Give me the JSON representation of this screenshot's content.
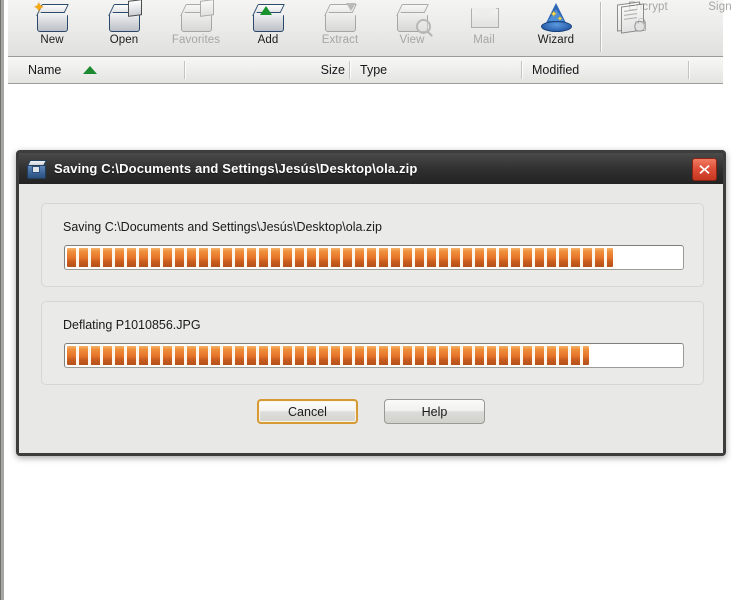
{
  "window": {
    "toolbar": {
      "buttons": [
        {
          "label": "New",
          "icon": "new-archive-icon",
          "enabled": true
        },
        {
          "label": "Open",
          "icon": "open-archive-icon",
          "enabled": true
        },
        {
          "label": "Favorites",
          "icon": "favorites-icon",
          "enabled": false
        },
        {
          "label": "Add",
          "icon": "add-to-archive-icon",
          "enabled": true
        },
        {
          "label": "Extract",
          "icon": "extract-icon",
          "enabled": false
        },
        {
          "label": "View",
          "icon": "view-icon",
          "enabled": false
        },
        {
          "label": "Mail",
          "icon": "mail-icon",
          "enabled": false
        },
        {
          "label": "Wizard",
          "icon": "wizard-hat-icon",
          "enabled": true
        }
      ],
      "buttons_right": [
        {
          "label": "Encrypt",
          "icon": "encrypt-lock-icon",
          "enabled": false
        },
        {
          "label": "Sign",
          "icon": "sign-seal-icon",
          "enabled": false
        }
      ]
    },
    "columns": [
      {
        "label": "Name",
        "sort": "ascending"
      },
      {
        "label": "Size",
        "sort": "none"
      },
      {
        "label": "Type",
        "sort": "none"
      },
      {
        "label": "Modified",
        "sort": "none"
      }
    ],
    "file_list_rows": []
  },
  "dialog": {
    "title": "Saving C:\\Documents and Settings\\Jesús\\Desktop\\ola.zip",
    "title_icon": "archive-box-icon",
    "close_icon": "close-icon",
    "overall": {
      "label": "Saving C:\\Documents and Settings\\Jesús\\Desktop\\ola.zip",
      "percent": 89
    },
    "current": {
      "label": "Deflating P1010856.JPG",
      "percent": 85
    },
    "buttons": [
      {
        "label": "Cancel",
        "default": true
      },
      {
        "label": "Help",
        "default": false
      }
    ]
  },
  "colors": {
    "progress_accent": "#e6752a",
    "default_button_focus": "#d69a34",
    "close_button": "#e05038",
    "sort_arrow": "#1c8a2e",
    "title_bar": "#2f2f2f"
  }
}
